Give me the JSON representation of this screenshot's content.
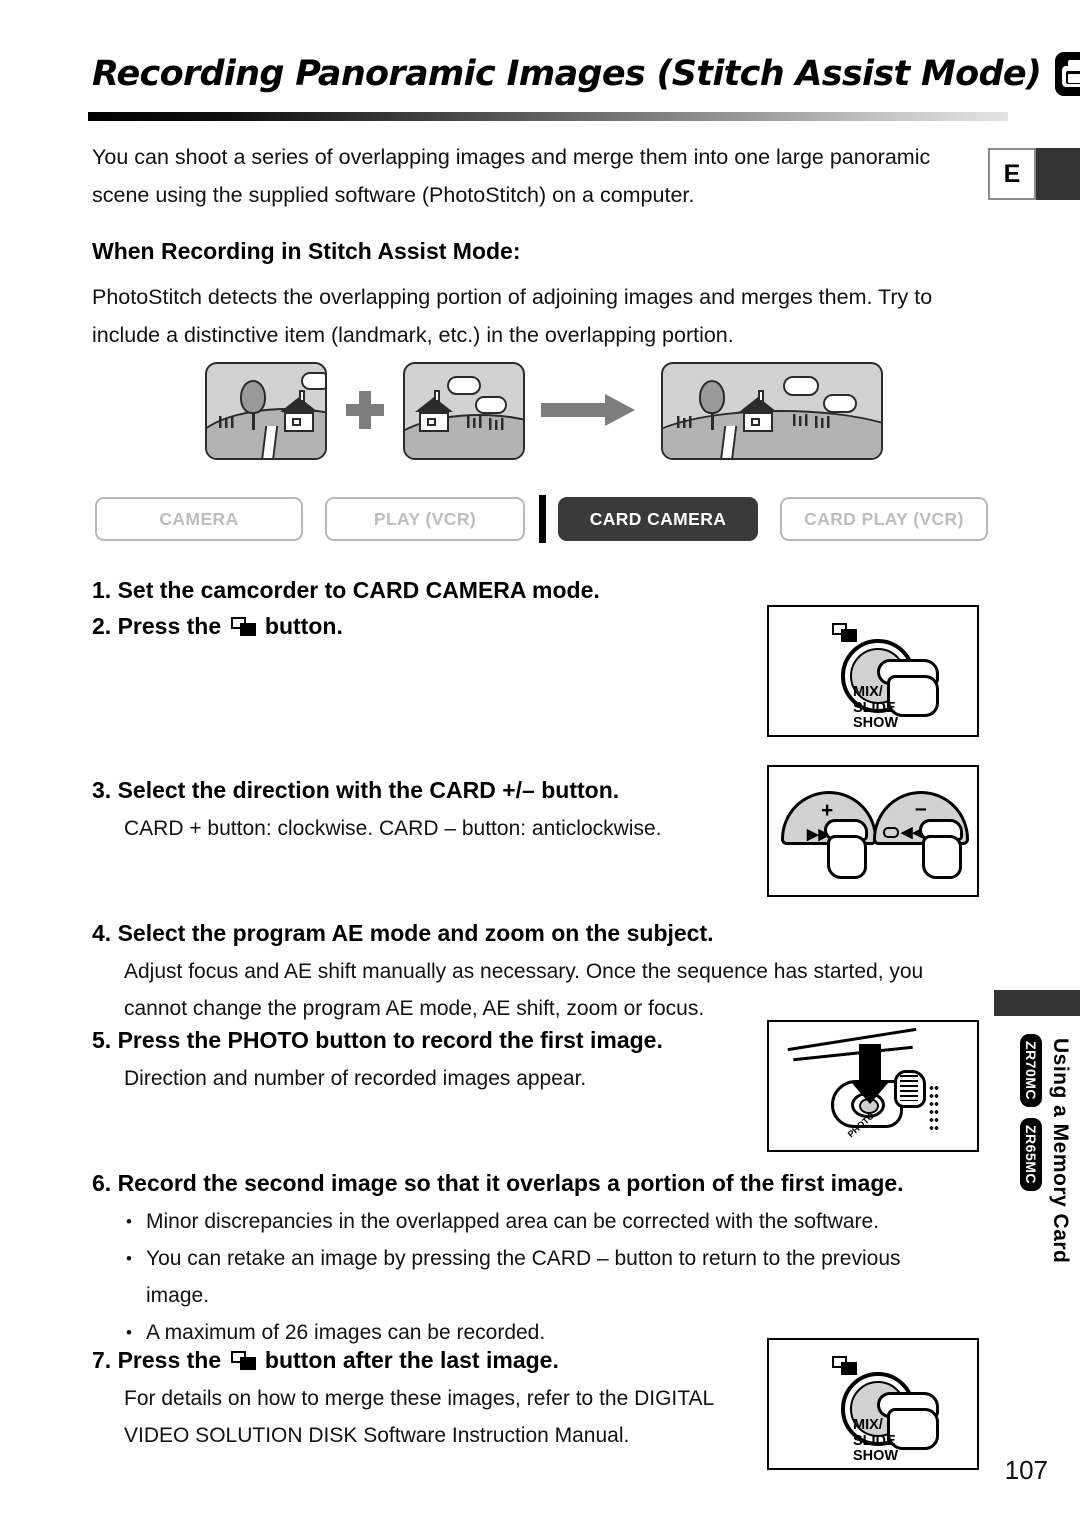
{
  "header": {
    "title": "Recording Panoramic Images (Stitch Assist Mode)",
    "card_icon": "memory-card-icon",
    "language_tab": "E"
  },
  "intro": "You can shoot a series of overlapping images and merge them into one large panoramic scene using the supplied software (PhotoStitch) on a computer.",
  "section": {
    "heading": "When Recording in Stitch Assist Mode:",
    "body": "PhotoStitch detects the overlapping portion of adjoining images and merges them. Try to include a distinctive item (landmark, etc.) in the overlapping portion."
  },
  "modes": [
    {
      "label": "CAMERA",
      "active": false
    },
    {
      "label": "PLAY (VCR)",
      "active": false
    },
    {
      "label": "CARD CAMERA",
      "active": true
    },
    {
      "label": "CARD PLAY (VCR)",
      "active": false
    }
  ],
  "steps": {
    "s1": "1. Set the camcorder to CARD CAMERA mode.",
    "s2_pre": "2. Press the",
    "s2_post": "button.",
    "s3_head": "3. Select the direction with the CARD +/– button.",
    "s3_body": "CARD + button: clockwise. CARD – button: anticlockwise.",
    "s4_head": "4. Select the program AE mode and zoom on the subject.",
    "s4_body": "Adjust focus and AE shift manually as necessary. Once the sequence has started, you cannot change the program AE mode, AE shift, zoom or focus.",
    "s5_head": "5. Press the PHOTO button to record the first image.",
    "s5_body": "Direction and number of recorded images appear.",
    "s6_head": "6. Record the second image so that it overlaps a portion of the first image.",
    "s6_bullets": [
      "Minor discrepancies in the overlapped area can be corrected with the software.",
      "You can retake an image by pressing the CARD – button to return to the previous",
      "image.",
      "A maximum of 26 images can be recorded."
    ],
    "s7_pre": "7. Press the",
    "s7_post": "button after the last image.",
    "s7_body": "For details on how to merge these images, refer to the DIGITAL VIDEO SOLUTION DISK Software Instruction Manual."
  },
  "illustrations": {
    "mix_slide_show_label": [
      "MIX/",
      "SLIDE",
      "SHOW"
    ],
    "plus_label": "+",
    "minus_label": "–",
    "ff_label": "▶▶",
    "rew_label": "◀◀",
    "photo_label": "PHOTO"
  },
  "side_tab": {
    "text": "Using a Memory Card",
    "models": [
      "ZR70MC",
      "ZR65MC"
    ]
  },
  "page_number": "107",
  "colors": {
    "active_mode_bg": "#3a3a3a",
    "inactive_mode_border": "#b8b8b8",
    "scene_sky": "#d2d2d2",
    "scene_ground": "#b3b3b3",
    "arrow_gray": "#7d7d7d"
  }
}
